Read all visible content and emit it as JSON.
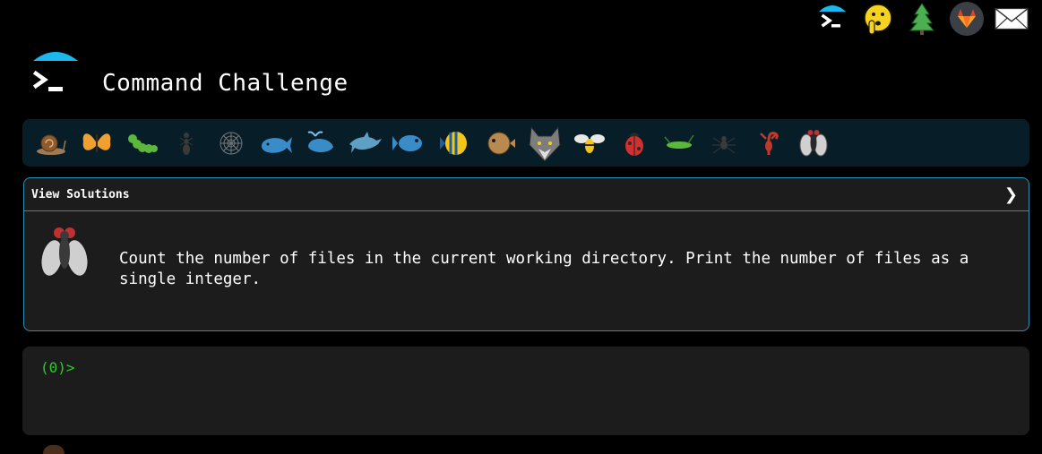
{
  "header": {
    "title": "Command Challenge",
    "logo_icon": "terminal-prompt-icon"
  },
  "top_icons": [
    {
      "name": "terminal-hat-icon"
    },
    {
      "name": "shushing-face-icon"
    },
    {
      "name": "evergreen-tree-icon"
    },
    {
      "name": "gitlab-icon"
    },
    {
      "name": "envelope-icon"
    }
  ],
  "levels": [
    {
      "name": "snail-icon"
    },
    {
      "name": "butterfly-icon"
    },
    {
      "name": "caterpillar-icon"
    },
    {
      "name": "ant-icon"
    },
    {
      "name": "spider-web-icon"
    },
    {
      "name": "whale-icon"
    },
    {
      "name": "spouting-whale-icon"
    },
    {
      "name": "dolphin-icon"
    },
    {
      "name": "fish-icon"
    },
    {
      "name": "tropical-fish-icon"
    },
    {
      "name": "blowfish-icon"
    },
    {
      "name": "wolf-icon"
    },
    {
      "name": "bee-icon"
    },
    {
      "name": "ladybug-icon"
    },
    {
      "name": "cricket-icon"
    },
    {
      "name": "spider-icon"
    },
    {
      "name": "scorpion-icon"
    },
    {
      "name": "fly-icon"
    }
  ],
  "challenge": {
    "solutions_label": "View Solutions",
    "chevron": "❯",
    "icon": "fly-icon",
    "description": "Count the number of files in the current working directory. Print the number of files as a single integer."
  },
  "terminal": {
    "prompt": "(0)>"
  },
  "colors": {
    "background": "#000000",
    "level_bar": "#071d28",
    "card": "#1c1c1c",
    "card_border": "#2d8cb6",
    "prompt": "#25d025",
    "accent": "#1ab8ec"
  }
}
